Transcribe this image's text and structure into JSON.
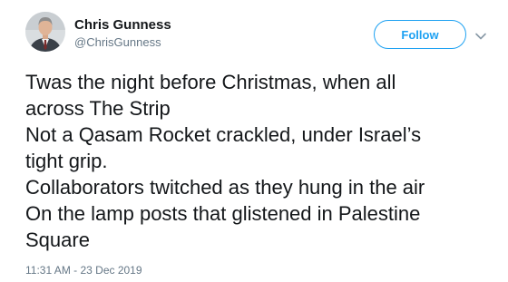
{
  "author": {
    "display_name": "Chris Gunness",
    "handle": "@ChrisGunness"
  },
  "actions": {
    "follow_label": "Follow",
    "more_icon": "chevron-down-icon"
  },
  "tweet": {
    "lines": [
      "Twas the night before Christmas, when all",
      "across The Strip",
      "Not a Qasam Rocket crackled, under Israel’s",
      "tight grip.",
      "Collaborators twitched as they hung in the air",
      "On the lamp posts that glistened in Palestine",
      "Square"
    ],
    "timestamp": "11:31 AM - 23 Dec 2019"
  },
  "colors": {
    "accent": "#1da1f2",
    "text": "#14171a",
    "secondary_text": "#657786"
  }
}
